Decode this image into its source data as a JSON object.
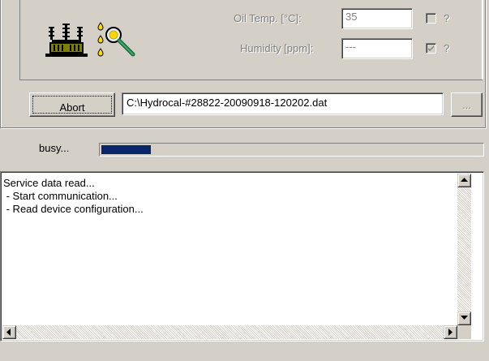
{
  "sensors": {
    "oil_temp": {
      "label": "Oil Temp. [°C]:",
      "value": "35",
      "checked": false,
      "help": "?"
    },
    "humidity": {
      "label": "Humidity [ppm]:",
      "value": "---",
      "checked": true,
      "help": "?"
    }
  },
  "actions": {
    "abort_label": "Abort",
    "file_path": "C:\\Hydrocal-#28822-20090918-120202.dat",
    "browse_label": "..."
  },
  "status": {
    "text": "busy...",
    "progress": 0.13,
    "color": "#0a246a"
  },
  "log": {
    "lines": "Service data read...\n - Start communication...\n - Read device configuration..."
  },
  "icons": [
    "transformer-icon",
    "oil-drop-magnifier-icon",
    "checkbox-check-icon",
    "scroll-up-icon",
    "scroll-down-icon",
    "scroll-left-icon",
    "scroll-right-icon"
  ]
}
